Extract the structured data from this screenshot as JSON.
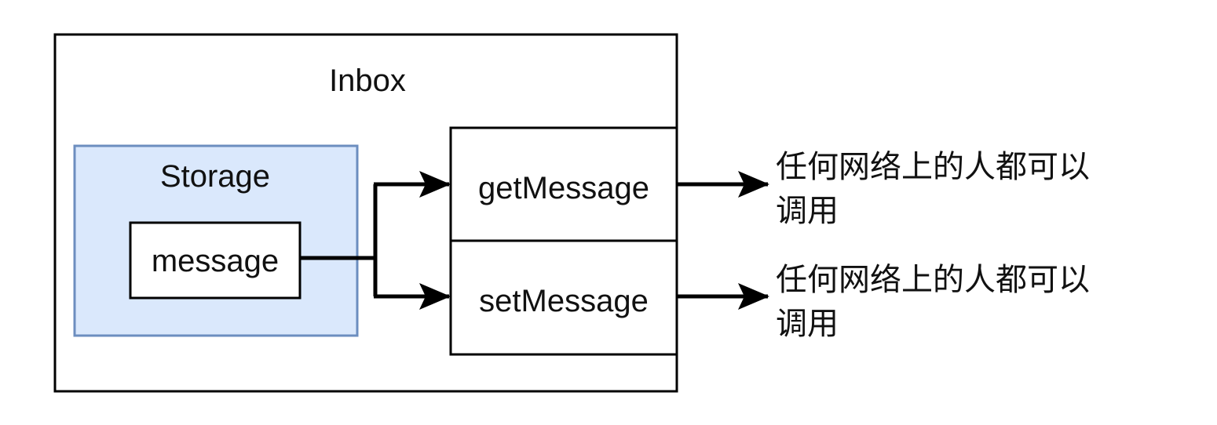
{
  "inbox": {
    "label": "Inbox"
  },
  "storage": {
    "label": "Storage",
    "fill": "#dae8fc",
    "stroke": "#6c8ebf"
  },
  "message": {
    "label": "message"
  },
  "methods": [
    {
      "label": "getMessage",
      "note_line1": "任何网络上的人都可以",
      "note_line2": "调用"
    },
    {
      "label": "setMessage",
      "note_line1": "任何网络上的人都可以",
      "note_line2": "调用"
    }
  ]
}
